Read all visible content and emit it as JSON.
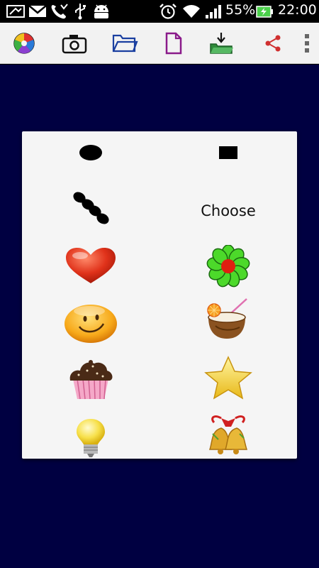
{
  "status_bar": {
    "battery_percent": "55%",
    "time": "22:00",
    "icons": [
      "screenshot-icon",
      "gmail-icon",
      "missed-call-icon",
      "usb-icon",
      "android-icon",
      "alarm-icon",
      "wifi-icon",
      "signal-icon",
      "battery-icon"
    ]
  },
  "toolbar": {
    "buttons": [
      "color-palette-icon",
      "camera-icon",
      "open-folder-icon",
      "new-file-icon",
      "save-download-icon",
      "share-icon",
      "overflow-menu-icon"
    ]
  },
  "brush_dialog": {
    "choose_label": "Choose",
    "items": [
      {
        "name": "oval-brush"
      },
      {
        "name": "square-brush"
      },
      {
        "name": "dots-brush"
      },
      {
        "name": "choose"
      },
      {
        "name": "heart-sticker"
      },
      {
        "name": "flower-sticker"
      },
      {
        "name": "smiley-sticker"
      },
      {
        "name": "coconut-drink-sticker"
      },
      {
        "name": "cupcake-sticker"
      },
      {
        "name": "star-sticker"
      },
      {
        "name": "lightbulb-sticker"
      },
      {
        "name": "bells-sticker"
      }
    ]
  },
  "colors": {
    "canvas_background": "#000041",
    "dialog_background": "#f5f5f5",
    "toolbar_background": "#f2f2f2"
  }
}
